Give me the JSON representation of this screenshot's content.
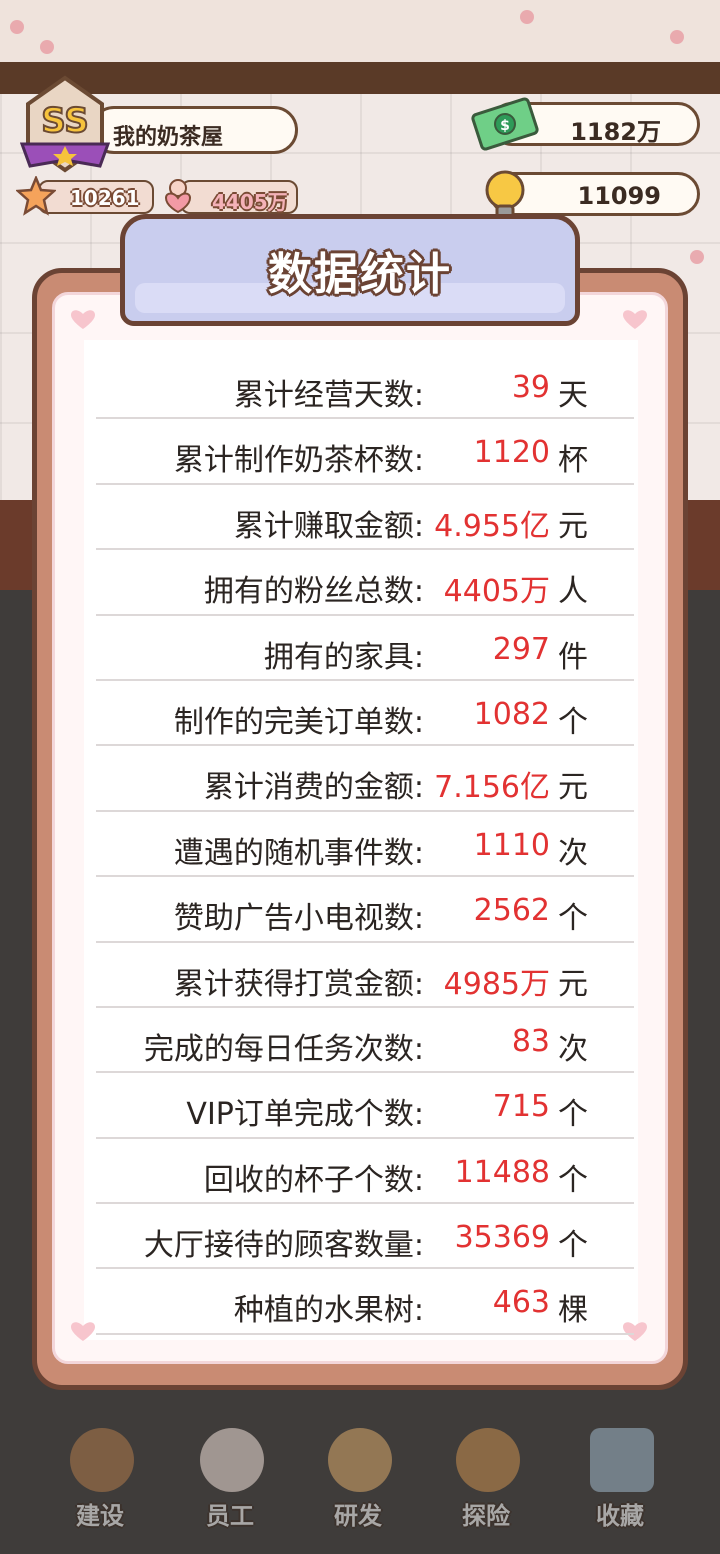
{
  "hud": {
    "rank": "SS",
    "shop_name": "我的奶茶屋",
    "stars": "10261",
    "fans": "4405万",
    "money": "1182万",
    "ideas": "11099"
  },
  "panel": {
    "title": "数据统计",
    "rows": [
      {
        "label": "累计经营天数:",
        "value": "39",
        "unit": "天"
      },
      {
        "label": "累计制作奶茶杯数:",
        "value": "1120",
        "unit": "杯"
      },
      {
        "label": "累计赚取金额:",
        "value": "4.955亿",
        "unit": "元"
      },
      {
        "label": "拥有的粉丝总数:",
        "value": "4405万",
        "unit": "人"
      },
      {
        "label": "拥有的家具:",
        "value": "297",
        "unit": "件"
      },
      {
        "label": "制作的完美订单数:",
        "value": "1082",
        "unit": "个"
      },
      {
        "label": "累计消费的金额:",
        "value": "7.156亿",
        "unit": "元"
      },
      {
        "label": "遭遇的随机事件数:",
        "value": "1110",
        "unit": "次"
      },
      {
        "label": "赞助广告小电视数:",
        "value": "2562",
        "unit": "个"
      },
      {
        "label": "累计获得打赏金额:",
        "value": "4985万",
        "unit": "元"
      },
      {
        "label": "完成的每日任务次数:",
        "value": "83",
        "unit": "次"
      },
      {
        "label": "VIP订单完成个数:",
        "value": "715",
        "unit": "个"
      },
      {
        "label": "回收的杯子个数:",
        "value": "11488",
        "unit": "个"
      },
      {
        "label": "大厅接待的顾客数量:",
        "value": "35369",
        "unit": "个"
      },
      {
        "label": "种植的水果树:",
        "value": "463",
        "unit": "棵"
      }
    ]
  },
  "nav": [
    {
      "label": "建设",
      "icon": "hammer-brush-icon"
    },
    {
      "label": "员工",
      "icon": "paw-icon"
    },
    {
      "label": "研发",
      "icon": "milk-tea-icon"
    },
    {
      "label": "探险",
      "icon": "compass-icon"
    },
    {
      "label": "收藏",
      "icon": "book-icon"
    }
  ],
  "colors": {
    "value_red": "#e23232",
    "frame_brown": "#6b4334",
    "banner_lavender": "#c9cdee"
  }
}
